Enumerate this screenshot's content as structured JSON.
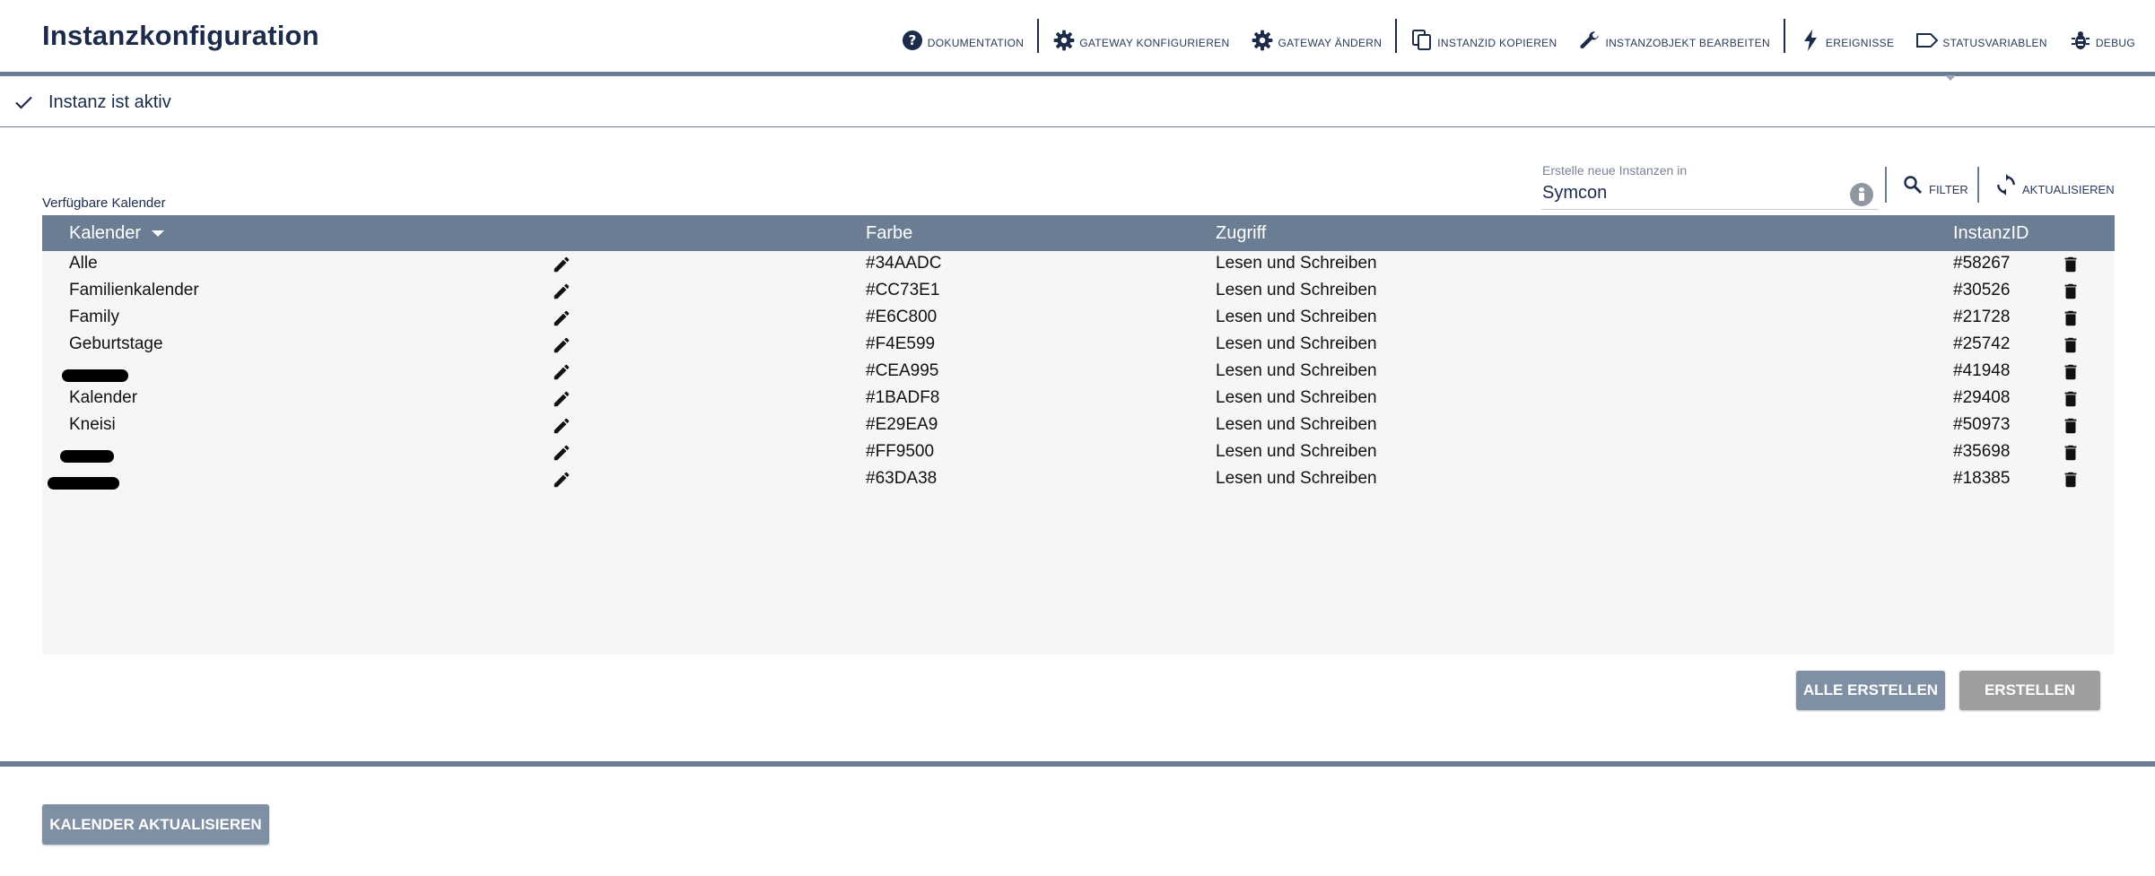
{
  "page": {
    "title": "Instanzkonfiguration"
  },
  "toolbar": [
    {
      "icon": "help-circle-icon",
      "label": "Dokumentation"
    },
    {
      "sep": true
    },
    {
      "icon": "gear-icon",
      "label": "Gateway konfigurieren"
    },
    {
      "icon": "gear-icon",
      "label": "Gateway ändern"
    },
    {
      "sep": true
    },
    {
      "icon": "copy-icon",
      "label": "InstanzID kopieren"
    },
    {
      "icon": "wrench-icon",
      "label": "Instanzobjekt bearbeiten"
    },
    {
      "sep": true
    },
    {
      "icon": "lightning-icon",
      "label": "Ereignisse"
    },
    {
      "icon": "tag-icon",
      "label": "Statusvariablen"
    },
    {
      "icon": "bug-icon",
      "label": "Debug"
    }
  ],
  "status": {
    "text": "Instanz ist aktiv"
  },
  "list": {
    "caption": "Verfügbare Kalender",
    "create_in_caption": "Erstelle neue Instanzen in",
    "create_in_value": "Symcon",
    "filter_label": "Filter",
    "refresh_label": "Aktualisieren",
    "columns": {
      "kalender": "Kalender",
      "farbe": "Farbe",
      "zugriff": "Zugriff",
      "instanzid": "InstanzID"
    },
    "rows": [
      {
        "name": "Alle",
        "color": "#34AADC",
        "access": "Lesen und Schreiben",
        "id": "#58267"
      },
      {
        "name": "Familienkalender",
        "color": "#CC73E1",
        "access": "Lesen und Schreiben",
        "id": "#30526"
      },
      {
        "name": "Family",
        "color": "#E6C800",
        "access": "Lesen und Schreiben",
        "id": "#21728"
      },
      {
        "name": "Geburtstage",
        "color": "#F4E599",
        "access": "Lesen und Schreiben",
        "id": "#25742"
      },
      {
        "name": "",
        "redacted": true,
        "color": "#CEA995",
        "access": "Lesen und Schreiben",
        "id": "#41948"
      },
      {
        "name": "Kalender",
        "color": "#1BADF8",
        "access": "Lesen und Schreiben",
        "id": "#29408"
      },
      {
        "name": "Kneisi",
        "color": "#E29EA9",
        "access": "Lesen und Schreiben",
        "id": "#50973"
      },
      {
        "name": "",
        "redacted": true,
        "color": "#FF9500",
        "access": "Lesen und Schreiben",
        "id": "#35698"
      },
      {
        "name": "",
        "redacted": true,
        "color": "#63DA38",
        "access": "Lesen und Schreiben",
        "id": "#18385"
      }
    ]
  },
  "buttons": {
    "create_all": "Alle erstellen",
    "create": "Erstellen",
    "refresh_calendars": "Kalender aktualisieren"
  }
}
